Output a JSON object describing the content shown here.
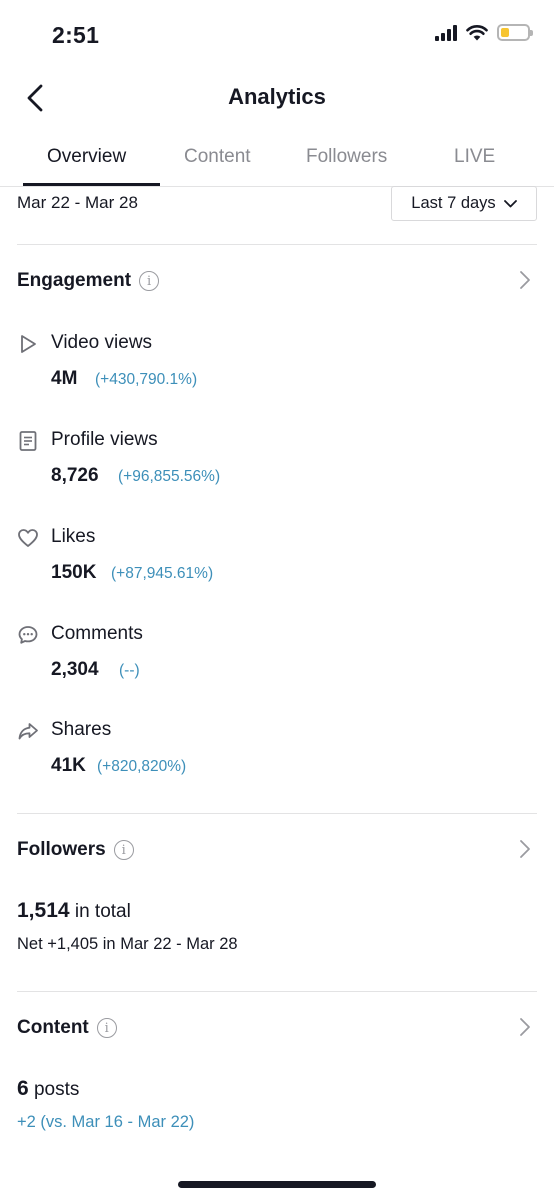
{
  "status_bar": {
    "time": "2:51"
  },
  "header": {
    "title": "Analytics"
  },
  "tabs": [
    {
      "label": "Overview"
    },
    {
      "label": "Content"
    },
    {
      "label": "Followers"
    },
    {
      "label": "LIVE"
    }
  ],
  "date_range": {
    "label": "Mar 22 - Mar 28",
    "selected_range": "Last 7 days"
  },
  "engagement": {
    "title": "Engagement",
    "metrics": [
      {
        "icon": "play-icon",
        "label": "Video views",
        "value": "4M",
        "change": "(+430,790.1%)"
      },
      {
        "icon": "profile-document-icon",
        "label": "Profile views",
        "value": "8,726",
        "change": "(+96,855.56%)"
      },
      {
        "icon": "heart-icon",
        "label": "Likes",
        "value": "150K",
        "change": "(+87,945.61%)"
      },
      {
        "icon": "comment-icon",
        "label": "Comments",
        "value": "2,304",
        "change": "(--)"
      },
      {
        "icon": "share-icon",
        "label": "Shares",
        "value": "41K",
        "change": "(+820,820%)"
      }
    ]
  },
  "followers": {
    "title": "Followers",
    "total": "1,514",
    "total_suffix": "in total",
    "net": "Net +1,405 in Mar 22 - Mar 28"
  },
  "content": {
    "title": "Content",
    "posts": "6",
    "posts_suffix": "posts",
    "comparison": "+2 (vs. Mar 16 - Mar 22)"
  },
  "colors": {
    "text": "#161823",
    "muted": "#8a8b91",
    "change_blue": "#3d8fb9",
    "battery": "#f7c531"
  }
}
